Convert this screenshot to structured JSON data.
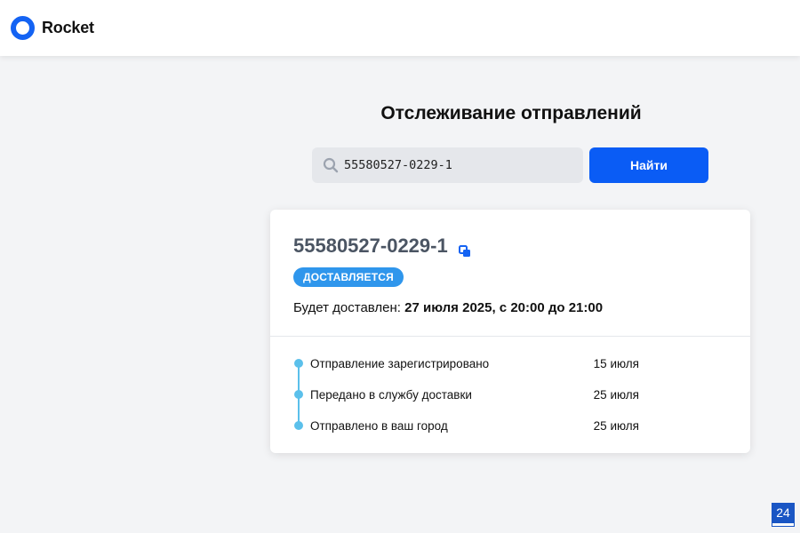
{
  "header": {
    "brand": "Rocket",
    "accent_color": "#1463f3"
  },
  "tracking": {
    "title": "Отслеживание отправлений",
    "search": {
      "value": "55580527-0229-1",
      "icon": "search-icon"
    },
    "find_label": "Найти"
  },
  "shipment": {
    "number": "55580527-0229-1",
    "copy_icon": "copy-icon",
    "status": "ДОСТАВЛЯЕТСЯ",
    "status_color": "#2f96ec",
    "delivery_prefix": "Будет доставлен: ",
    "delivery_window": "27 июля 2025, с 20:00 до 21:00",
    "events": [
      {
        "label": "Отправление зарегистрировано",
        "date": "15 июля"
      },
      {
        "label": "Передано в службу доставки",
        "date": "25 июля"
      },
      {
        "label": "Отправлено в ваш город",
        "date": "25 июля"
      }
    ]
  },
  "corner_badge": "24"
}
